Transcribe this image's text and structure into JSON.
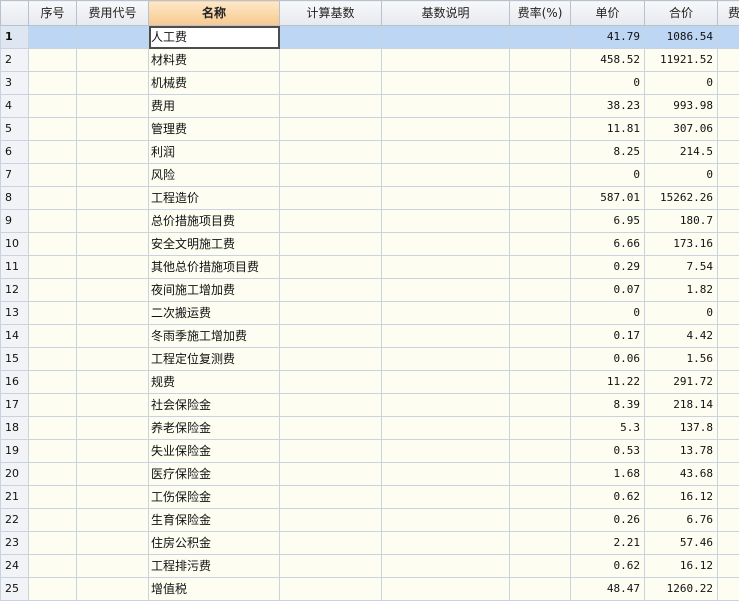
{
  "columns": [
    "",
    "序号",
    "费用代号",
    "名称",
    "计算基数",
    "基数说明",
    "费率(%)",
    "单价",
    "合价",
    "费"
  ],
  "rows": [
    {
      "no": "1",
      "name": "人工费",
      "unit_price": "41.79",
      "total": "1086.54"
    },
    {
      "no": "2",
      "name": "材料费",
      "unit_price": "458.52",
      "total": "11921.52"
    },
    {
      "no": "3",
      "name": "机械费",
      "unit_price": "0",
      "total": "0"
    },
    {
      "no": "4",
      "name": "费用",
      "unit_price": "38.23",
      "total": "993.98"
    },
    {
      "no": "5",
      "name": "管理费",
      "unit_price": "11.81",
      "total": "307.06"
    },
    {
      "no": "6",
      "name": "利润",
      "unit_price": "8.25",
      "total": "214.5"
    },
    {
      "no": "7",
      "name": "风险",
      "unit_price": "0",
      "total": "0"
    },
    {
      "no": "8",
      "name": "工程造价",
      "unit_price": "587.01",
      "total": "15262.26"
    },
    {
      "no": "9",
      "name": "总价措施项目费",
      "unit_price": "6.95",
      "total": "180.7"
    },
    {
      "no": "10",
      "name": "安全文明施工费",
      "unit_price": "6.66",
      "total": "173.16"
    },
    {
      "no": "11",
      "name": "其他总价措施项目费",
      "unit_price": "0.29",
      "total": "7.54"
    },
    {
      "no": "12",
      "name": "夜间施工增加费",
      "unit_price": "0.07",
      "total": "1.82"
    },
    {
      "no": "13",
      "name": "二次搬运费",
      "unit_price": "0",
      "total": "0"
    },
    {
      "no": "14",
      "name": "冬雨季施工增加费",
      "unit_price": "0.17",
      "total": "4.42"
    },
    {
      "no": "15",
      "name": "工程定位复测费",
      "unit_price": "0.06",
      "total": "1.56"
    },
    {
      "no": "16",
      "name": "规费",
      "unit_price": "11.22",
      "total": "291.72"
    },
    {
      "no": "17",
      "name": "社会保险金",
      "unit_price": "8.39",
      "total": "218.14"
    },
    {
      "no": "18",
      "name": "养老保险金",
      "unit_price": "5.3",
      "total": "137.8"
    },
    {
      "no": "19",
      "name": "失业保险金",
      "unit_price": "0.53",
      "total": "13.78"
    },
    {
      "no": "20",
      "name": "医疗保险金",
      "unit_price": "1.68",
      "total": "43.68"
    },
    {
      "no": "21",
      "name": "工伤保险金",
      "unit_price": "0.62",
      "total": "16.12"
    },
    {
      "no": "22",
      "name": "生育保险金",
      "unit_price": "0.26",
      "total": "6.76"
    },
    {
      "no": "23",
      "name": "住房公积金",
      "unit_price": "2.21",
      "total": "57.46"
    },
    {
      "no": "24",
      "name": "工程排污费",
      "unit_price": "0.62",
      "total": "16.12"
    },
    {
      "no": "25",
      "name": "增值税",
      "unit_price": "48.47",
      "total": "1260.22"
    }
  ],
  "selected_row": 0,
  "colors": {
    "selection": "#bcd6f3",
    "header_highlight": "#f7c98f",
    "cell_background": "#fdfdf2"
  }
}
